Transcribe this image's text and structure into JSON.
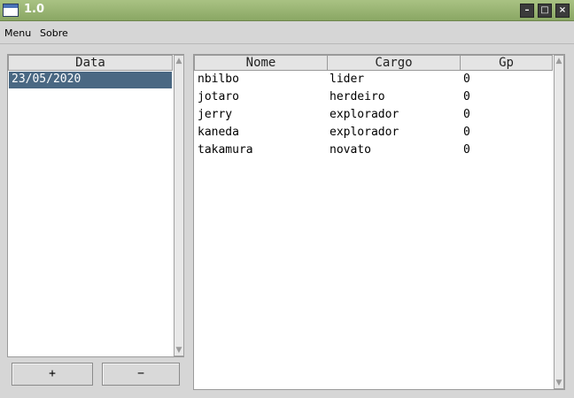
{
  "window": {
    "title": "1.0",
    "buttons": [
      "minimize",
      "maximize",
      "close"
    ]
  },
  "menu": {
    "items": [
      "Menu",
      "Sobre"
    ]
  },
  "dates_panel": {
    "header": "Data",
    "rows": [
      "23/05/2020"
    ],
    "selected_index": 0,
    "add_label": "+",
    "remove_label": "−"
  },
  "members_table": {
    "headers": [
      "Nome",
      "Cargo",
      "Gp"
    ],
    "rows": [
      [
        "nbilbo",
        "lider",
        "0"
      ],
      [
        "jotaro",
        "herdeiro",
        "0"
      ],
      [
        "jerry",
        "explorador",
        "0"
      ],
      [
        "kaneda",
        "explorador",
        "0"
      ],
      [
        "takamura",
        "novato",
        "0"
      ]
    ]
  },
  "colors": {
    "titlebar": "#8aa764",
    "selection": "#4a6883",
    "background": "#d6d6d6"
  }
}
